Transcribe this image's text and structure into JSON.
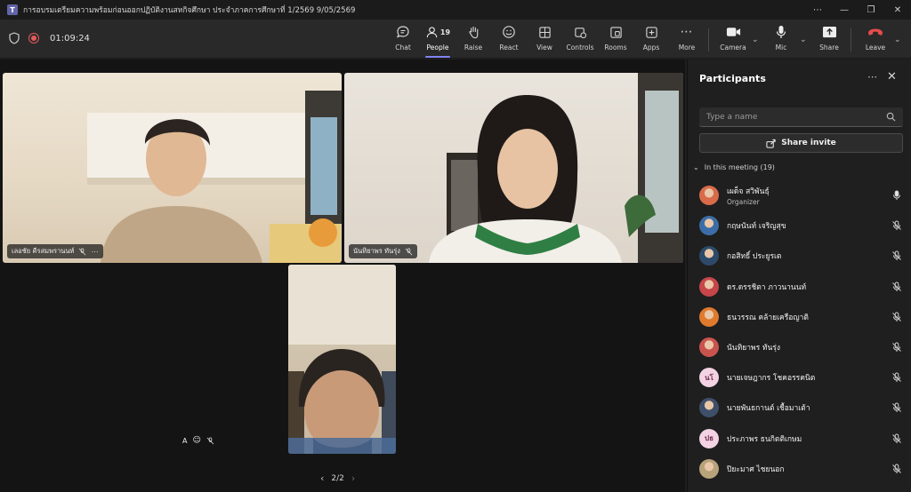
{
  "window": {
    "title": "การอบรมเตรียมความพร้อมก่อนออกปฏิบัติงานสหกิจศึกษา ประจำภาคการศึกษาที่ 1/2569 9/05/2569",
    "app_icon_letter": "T"
  },
  "toolbar": {
    "timer": "01:09:24",
    "chat_label": "Chat",
    "people_label": "People",
    "people_count": "19",
    "raise_label": "Raise",
    "react_label": "React",
    "view_label": "View",
    "controls_label": "Controls",
    "rooms_label": "Rooms",
    "apps_label": "Apps",
    "more_label": "More",
    "camera_label": "Camera",
    "mic_label": "Mic",
    "share_label": "Share",
    "leave_label": "Leave",
    "leave_color": "#e74c4c",
    "active_color": "#7f85f5"
  },
  "stage": {
    "tiles": [
      {
        "name": "เลอชัย คีรสมพรานนท์"
      },
      {
        "name": "นันทิยาพร ทันรุ่ง"
      },
      {
        "name": ""
      }
    ],
    "floating_chip_letter": "A",
    "pager": "2/2"
  },
  "panel": {
    "title": "Participants",
    "search_placeholder": "Type a name",
    "share_invite_label": "Share invite",
    "section_label": "In this meeting (19)",
    "participants": [
      {
        "name": "เผด็จ สวิพันธุ์",
        "role": "Organizer",
        "avatar": "photo",
        "avatar_color": "#d96b4a",
        "mic": "on"
      },
      {
        "name": "กฤษนันท์ เจริญสุข",
        "role": "",
        "avatar": "photo",
        "avatar_color": "#3b6ea8",
        "mic": "muted"
      },
      {
        "name": "กอสิทธิ์ ประยูรเต",
        "role": "",
        "avatar": "photo",
        "avatar_color": "#2d4a6b",
        "mic": "muted"
      },
      {
        "name": "ดร.ดรรชิตา ภาวนานนท์",
        "role": "",
        "avatar": "photo",
        "avatar_color": "#c7464a",
        "mic": "muted"
      },
      {
        "name": "ธนวรรณ คล้ายเครือญาติ",
        "role": "",
        "avatar": "photo",
        "avatar_color": "#e07a2e",
        "mic": "muted"
      },
      {
        "name": "นันทิยาพร ทันรุ่ง",
        "role": "",
        "avatar": "photo",
        "avatar_color": "#c9544e",
        "mic": "muted"
      },
      {
        "name": "นายเจษฎากร โชคอรรคนิต",
        "role": "",
        "avatar": "initials",
        "initials": "นโ",
        "avatar_color": "#f3d3e3",
        "mic": "muted"
      },
      {
        "name": "นายพันธกานต์ เชื้อมาเต้า",
        "role": "",
        "avatar": "photo",
        "avatar_color": "#3e4f6a",
        "mic": "muted"
      },
      {
        "name": "ประภาพร ธนกิตติเกษม",
        "role": "",
        "avatar": "initials",
        "initials": "ปธ",
        "avatar_color": "#f3d3e3",
        "mic": "muted"
      },
      {
        "name": "ปิยะมาศ ไชยนอก",
        "role": "",
        "avatar": "photo",
        "avatar_color": "#b8a27a",
        "mic": "muted"
      }
    ]
  }
}
